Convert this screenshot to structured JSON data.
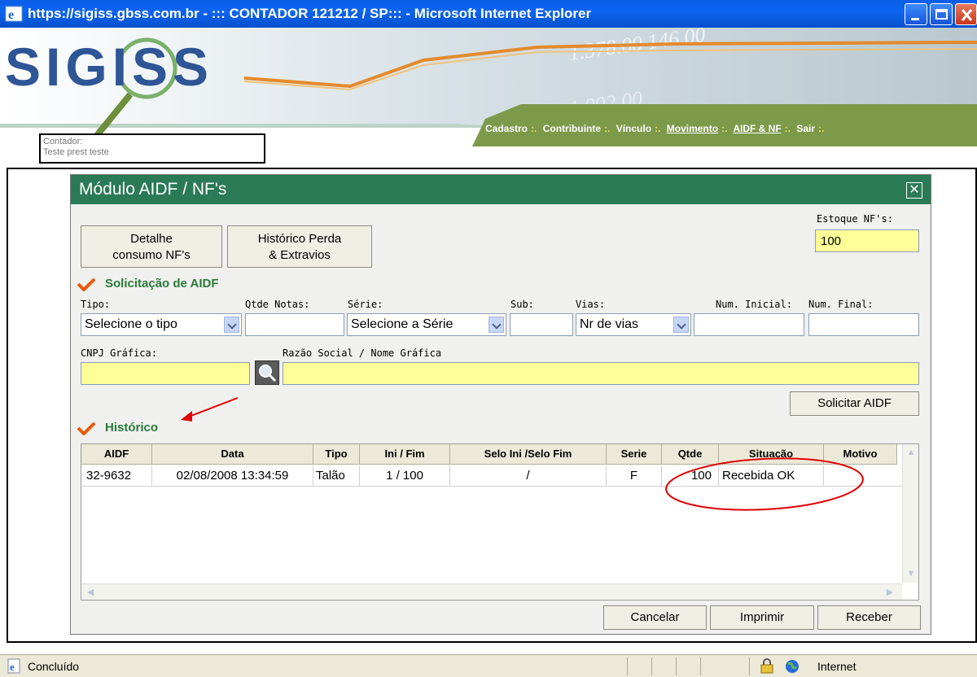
{
  "window": {
    "title": "https://sigiss.gbss.com.br - ::: CONTADOR 121212 / SP::: - Microsoft Internet Explorer"
  },
  "header": {
    "logo": "SIGISS",
    "contador_label": "Contador:",
    "contador_value": "Teste prest teste",
    "nav": [
      "Cadastro",
      "Contribuinte",
      "Vínculo",
      "Movimento",
      "AIDF & NF",
      "Sair"
    ],
    "nav_separator": ":."
  },
  "module": {
    "title": "Módulo AIDF / NF's",
    "buttons": {
      "detalhe_line1": "Detalhe",
      "detalhe_line2": "consumo NF's",
      "historico_line1": "Histórico Perda",
      "historico_line2": "& Extravios"
    },
    "estoque_label": "Estoque NF's:",
    "estoque_value": "100",
    "solicitacao": {
      "title": "Solicitação de AIDF",
      "labels": {
        "tipo": "Tipo:",
        "qtde": "Qtde Notas:",
        "serie": "Série:",
        "sub": "Sub:",
        "vias": "Vias:",
        "num_inicial": "Num. Inicial:",
        "num_final": "Num. Final:",
        "cnpj": "CNPJ Gráfica:",
        "razao": "Razão Social / Nome Gráfica"
      },
      "tipo_value": "Selecione o tipo",
      "serie_value": "Selecione a Série",
      "vias_value": "Nr de vias",
      "submit": "Solicitar AIDF"
    },
    "historico": {
      "title": "Histórico",
      "columns": [
        "AIDF",
        "Data",
        "Tipo",
        "Ini / Fim",
        "Selo Ini /Selo Fim",
        "Serie",
        "Qtde",
        "Situação",
        "Motivo"
      ],
      "rows": [
        [
          "32-9632",
          "02/08/2008 13:34:59",
          "Talão",
          "1 / 100",
          "/",
          "F",
          "100",
          "Recebida OK",
          ""
        ]
      ]
    },
    "actions": {
      "cancelar": "Cancelar",
      "imprimir": "Imprimir",
      "receber": "Receber"
    }
  },
  "statusbar": {
    "status": "Concluído",
    "zone": "Internet"
  },
  "colors": {
    "titlebar": "#0a5ee8",
    "module_header": "#2a7a56",
    "section_title": "#2a7a3a",
    "highlight_field": "#ffff99",
    "annotation": "#e00000"
  }
}
